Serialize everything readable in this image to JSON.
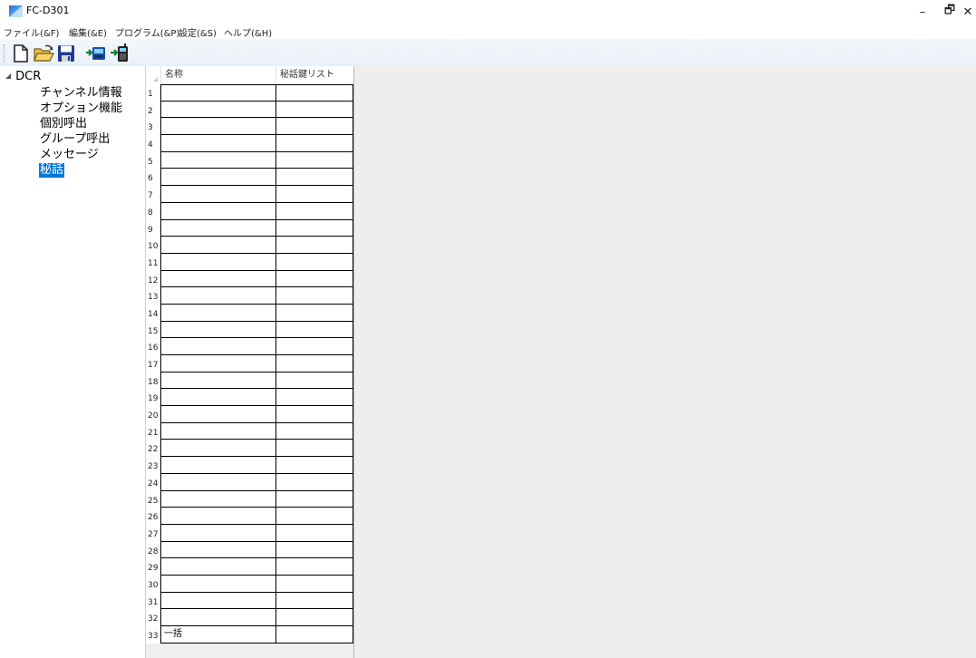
{
  "window": {
    "title": "FC-D301",
    "minimize_glyph": "–",
    "restore_glyph": "🗗",
    "close_glyph": "✕"
  },
  "menu": [
    {
      "label": "ファイル(&F)"
    },
    {
      "label": "編集(&E)"
    },
    {
      "label": "プログラム(&P)"
    },
    {
      "label": "設定(&S)"
    },
    {
      "label": "ヘルプ(&H)"
    }
  ],
  "toolbar": {
    "buttons": [
      {
        "icon": "new-file-icon"
      },
      {
        "icon": "open-folder-icon"
      },
      {
        "icon": "save-icon"
      },
      {
        "icon": "read-from-radio-icon"
      },
      {
        "icon": "write-to-radio-icon"
      }
    ]
  },
  "tree": {
    "root_label": "DCR",
    "root_arrow": "◢",
    "items": [
      {
        "label": "チャンネル情報",
        "selected": false
      },
      {
        "label": "オプション機能",
        "selected": false
      },
      {
        "label": "個別呼出",
        "selected": false
      },
      {
        "label": "グループ呼出",
        "selected": false
      },
      {
        "label": "メッセージ",
        "selected": false
      },
      {
        "label": "秘話",
        "selected": true
      }
    ]
  },
  "grid": {
    "headers": [
      "名称",
      "秘話鍵リスト"
    ],
    "rows": [
      {
        "num": "1",
        "name": "",
        "key_list": ""
      },
      {
        "num": "2",
        "name": "",
        "key_list": ""
      },
      {
        "num": "3",
        "name": "",
        "key_list": ""
      },
      {
        "num": "4",
        "name": "",
        "key_list": ""
      },
      {
        "num": "5",
        "name": "",
        "key_list": ""
      },
      {
        "num": "6",
        "name": "",
        "key_list": ""
      },
      {
        "num": "7",
        "name": "",
        "key_list": ""
      },
      {
        "num": "8",
        "name": "",
        "key_list": ""
      },
      {
        "num": "9",
        "name": "",
        "key_list": ""
      },
      {
        "num": "10",
        "name": "",
        "key_list": ""
      },
      {
        "num": "11",
        "name": "",
        "key_list": ""
      },
      {
        "num": "12",
        "name": "",
        "key_list": ""
      },
      {
        "num": "13",
        "name": "",
        "key_list": ""
      },
      {
        "num": "14",
        "name": "",
        "key_list": ""
      },
      {
        "num": "15",
        "name": "",
        "key_list": ""
      },
      {
        "num": "16",
        "name": "",
        "key_list": ""
      },
      {
        "num": "17",
        "name": "",
        "key_list": ""
      },
      {
        "num": "18",
        "name": "",
        "key_list": ""
      },
      {
        "num": "19",
        "name": "",
        "key_list": ""
      },
      {
        "num": "20",
        "name": "",
        "key_list": ""
      },
      {
        "num": "21",
        "name": "",
        "key_list": ""
      },
      {
        "num": "22",
        "name": "",
        "key_list": ""
      },
      {
        "num": "23",
        "name": "",
        "key_list": ""
      },
      {
        "num": "24",
        "name": "",
        "key_list": ""
      },
      {
        "num": "25",
        "name": "",
        "key_list": ""
      },
      {
        "num": "26",
        "name": "",
        "key_list": ""
      },
      {
        "num": "27",
        "name": "",
        "key_list": ""
      },
      {
        "num": "28",
        "name": "",
        "key_list": ""
      },
      {
        "num": "29",
        "name": "",
        "key_list": ""
      },
      {
        "num": "30",
        "name": "",
        "key_list": ""
      },
      {
        "num": "31",
        "name": "",
        "key_list": ""
      },
      {
        "num": "32",
        "name": "",
        "key_list": ""
      },
      {
        "num": "33",
        "name": "一括",
        "key_list": ""
      }
    ]
  },
  "colors": {
    "selection": "#0078d7",
    "empty_area": "#f0eded"
  }
}
